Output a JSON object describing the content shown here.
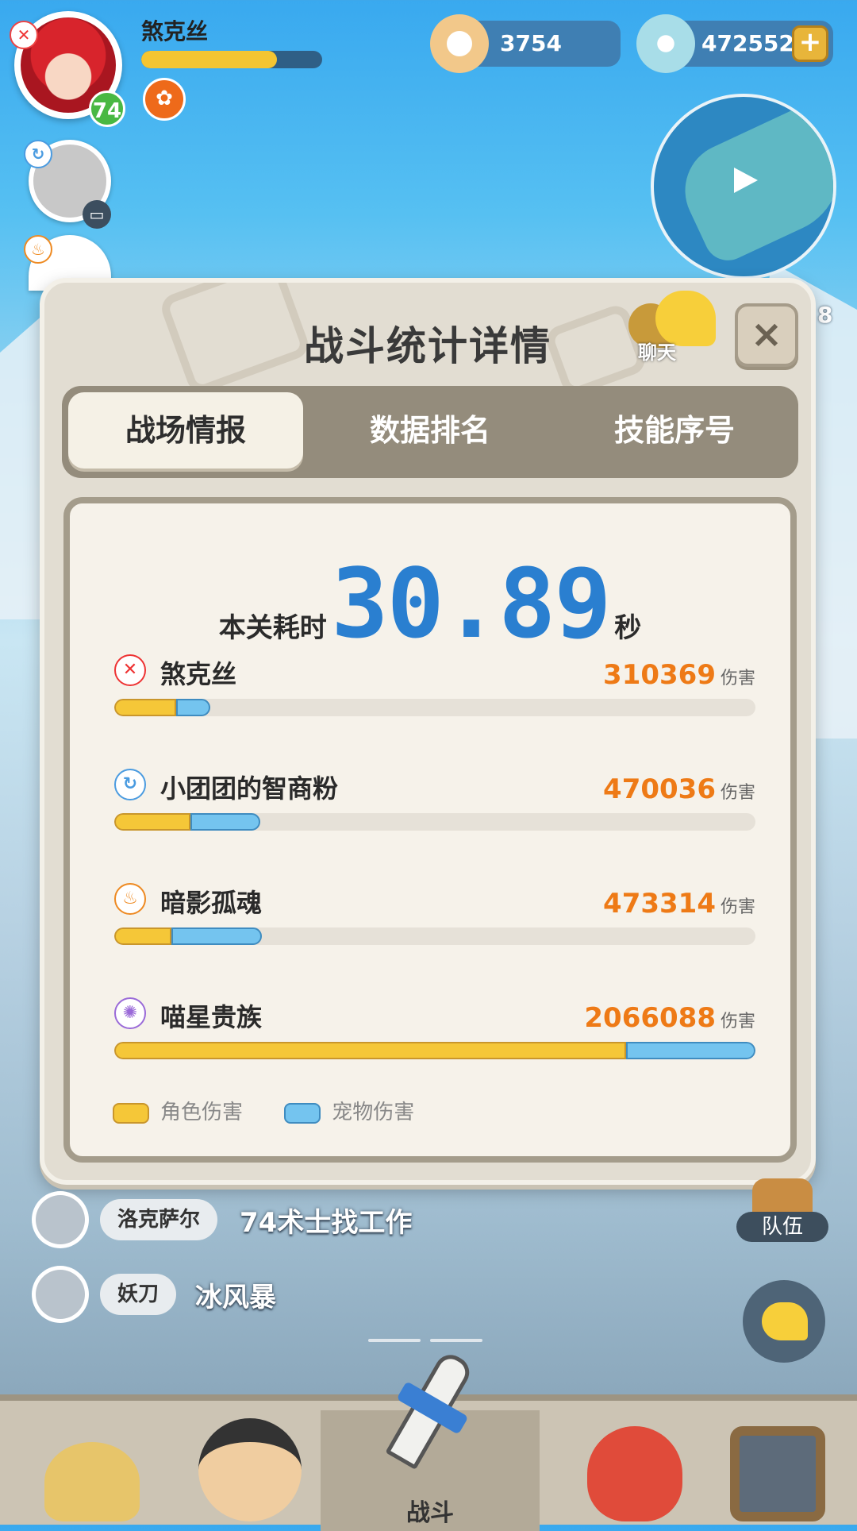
{
  "player": {
    "name": "煞克丝",
    "level": "74",
    "xp_fraction": 0.75
  },
  "currency": {
    "shells": "3754",
    "gems": "472552",
    "add_symbol": "+"
  },
  "side_number": "8",
  "panel": {
    "title": "战斗统计详情",
    "chat_label": "聊天",
    "close_symbol": "×",
    "tabs": [
      "战场情报",
      "数据排名",
      "技能序号"
    ],
    "active_tab": 0,
    "time_label": "本关耗时",
    "time_value": "30.89",
    "time_unit": "秒",
    "damage_unit": "伤害",
    "legend": {
      "char": "角色伤害",
      "pet": "宠物伤害"
    }
  },
  "chart_data": {
    "type": "bar",
    "title": "",
    "categories": [
      "煞克丝",
      "小团团的智商粉",
      "暗影孤魂",
      "喵星贵族"
    ],
    "totals": [
      310369,
      470036,
      473314,
      2066088
    ],
    "total_labels": [
      "310369",
      "470036",
      "473314",
      "2066088"
    ],
    "series": [
      {
        "name": "角色伤害",
        "values": [
          200000,
          245000,
          183000,
          1650000
        ]
      },
      {
        "name": "宠物伤害",
        "values": [
          110369,
          225036,
          290314,
          416088
        ]
      }
    ],
    "xlim": [
      0,
      2066088
    ],
    "colors": {
      "char": "#f5c738",
      "pet": "#74c4ef"
    }
  },
  "chat": [
    {
      "name": "洛克萨尔",
      "message": "74术士找工作"
    },
    {
      "name": "妖刀",
      "message": "冰风暴"
    }
  ],
  "team_label": "队伍",
  "nav": {
    "active_label": "战斗"
  },
  "colors": {
    "accent_blue": "#2a7fd0",
    "damage_orange": "#ee7a16",
    "panel_bg": "#e2ddd2"
  }
}
